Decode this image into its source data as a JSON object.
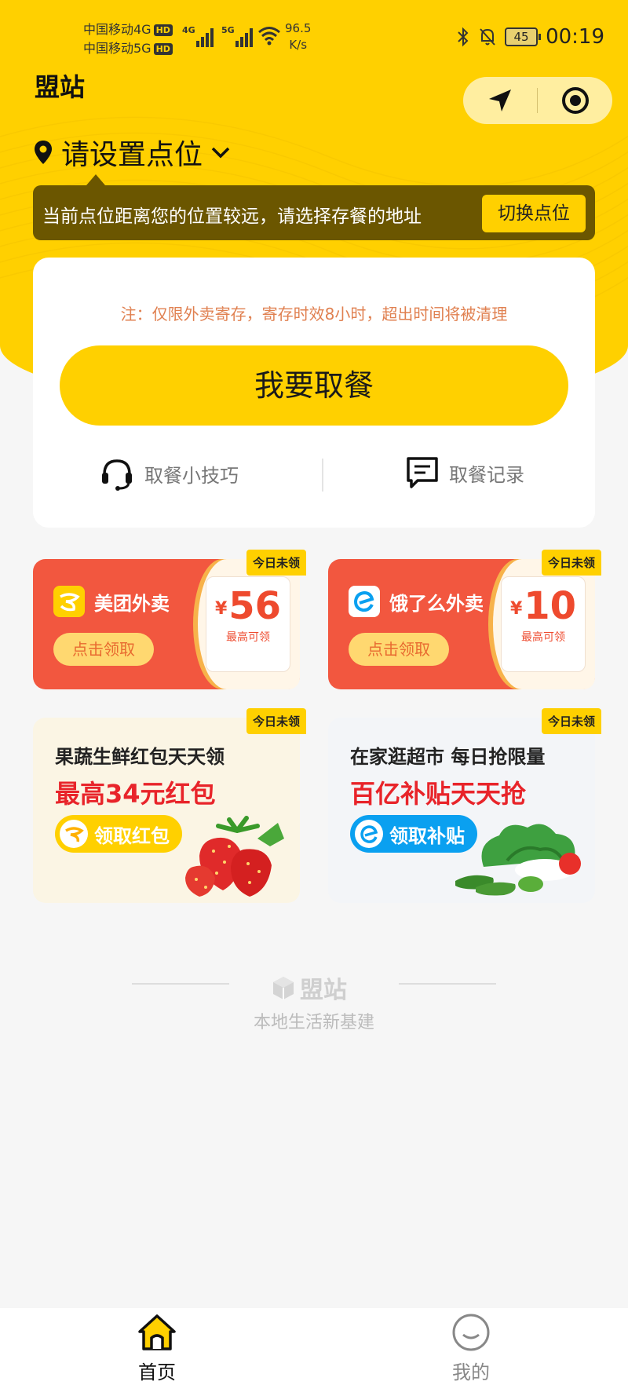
{
  "status_bar": {
    "carrier1": "中国移动4G",
    "carrier2": "中国移动5G",
    "hd": "HD",
    "net1": "4G",
    "net2": "5G",
    "speed_value": "96.5",
    "speed_unit": "K/s",
    "battery": "45",
    "time": "00:19"
  },
  "header": {
    "title": "盟站",
    "location_label": "请设置点位"
  },
  "banner": {
    "message": "当前点位距离您的位置较远，请选择存餐的地址",
    "switch_label": "切换点位"
  },
  "main_card": {
    "note": "注：仅限外卖寄存，寄存时效8小时，超出时间将被清理",
    "pickup_label": "我要取餐",
    "tips_label": "取餐小技巧",
    "records_label": "取餐记录"
  },
  "coupons": [
    {
      "brand": "美团外卖",
      "claim": "点击领取",
      "currency": "¥",
      "amount": "56",
      "sub": "最高可领",
      "tag": "今日未领"
    },
    {
      "brand": "饿了么外卖",
      "claim": "点击领取",
      "currency": "¥",
      "amount": "10",
      "sub": "最高可领",
      "tag": "今日未领"
    }
  ],
  "promos": [
    {
      "line1": "果蔬生鲜红包天天领",
      "line2": "最高34元红包",
      "cta": "领取红包",
      "tag": "今日未领"
    },
    {
      "line1": "在家逛超市 每日抢限量",
      "line2": "百亿补贴天天抢",
      "cta": "领取补贴",
      "tag": "今日未领"
    }
  ],
  "footer": {
    "logo_text": "盟站",
    "slogan": "本地生活新基建"
  },
  "tabs": {
    "home": "首页",
    "mine": "我的"
  },
  "colors": {
    "brand_yellow": "#ffd000",
    "coupon_red": "#f2573f",
    "promo_red": "#e8242a",
    "eleme_blue": "#0aa0f0"
  }
}
